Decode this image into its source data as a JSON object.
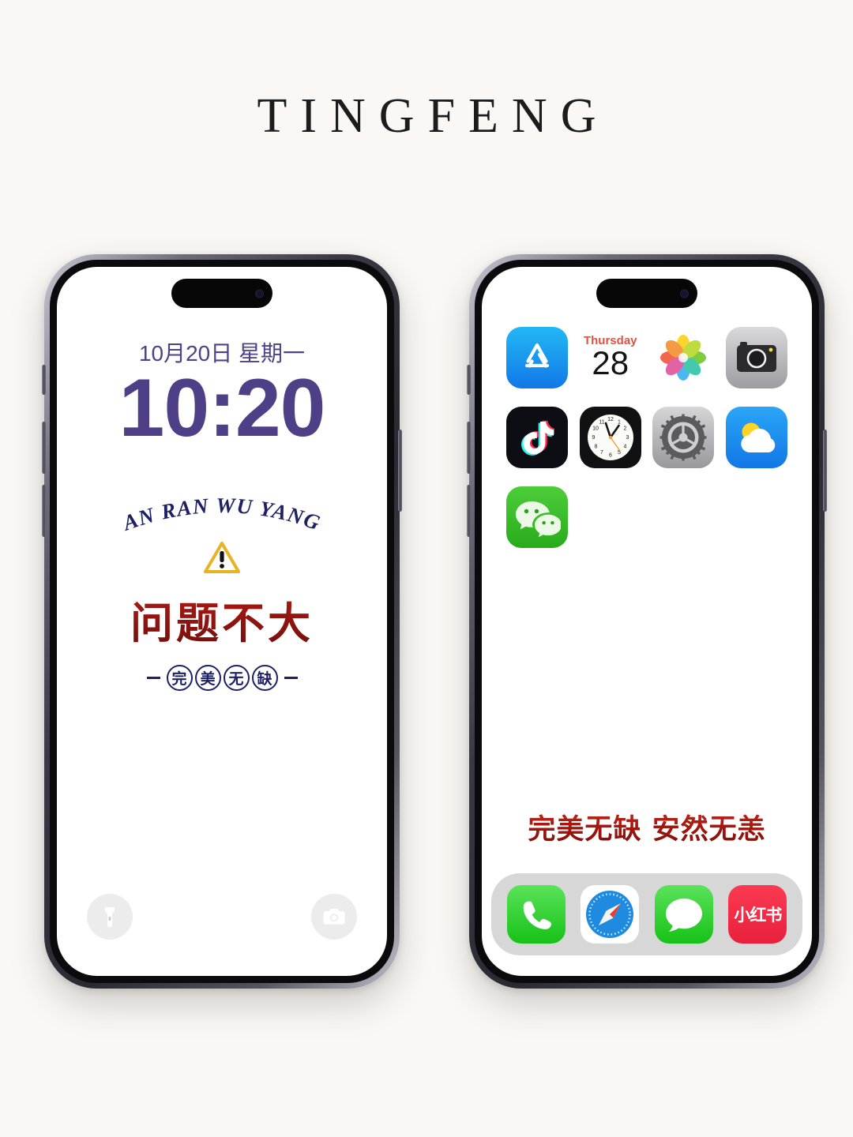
{
  "page": {
    "brand_title": "TINGFENG",
    "background_color": "#faf7f4"
  },
  "lock_screen": {
    "name": "iphone-lock-screen",
    "date": "10月20日 星期一",
    "time": "10:20",
    "time_color": "#4e3f87",
    "wallpaper": {
      "arch_text": "AN RAN WU YANG",
      "arch_color": "#1d2163",
      "warning_icon": "warning-triangle-icon",
      "warning_color": "#e8b322",
      "main_text": "问题不大",
      "main_color": "#9d1710",
      "sub_chars": [
        "完",
        "美",
        "无",
        "缺"
      ],
      "sub_color": "#1d2163"
    },
    "actions": [
      {
        "name": "flashlight-button",
        "icon": "flashlight-icon"
      },
      {
        "name": "camera-button",
        "icon": "camera-icon"
      }
    ]
  },
  "home_screen": {
    "name": "iphone-home-screen",
    "apps": [
      {
        "name": "app-store-icon",
        "label": "App Store"
      },
      {
        "name": "calendar-icon",
        "label": "Calendar",
        "weekday": "Thursday",
        "day": "28"
      },
      {
        "name": "photos-icon",
        "label": "Photos"
      },
      {
        "name": "camera-icon",
        "label": "Camera"
      },
      {
        "name": "tiktok-icon",
        "label": "抖音"
      },
      {
        "name": "clock-icon",
        "label": "Clock"
      },
      {
        "name": "settings-icon",
        "label": "Settings"
      },
      {
        "name": "weather-icon",
        "label": "Weather"
      },
      {
        "name": "wechat-icon",
        "label": "微信"
      }
    ],
    "slogan": "完美无缺  安然无恙",
    "slogan_color": "#a3160f",
    "dock": [
      {
        "name": "phone-icon",
        "label": "Phone"
      },
      {
        "name": "safari-icon",
        "label": "Safari"
      },
      {
        "name": "messages-icon",
        "label": "Messages"
      },
      {
        "name": "rednote-icon",
        "label": "小红书"
      }
    ]
  }
}
